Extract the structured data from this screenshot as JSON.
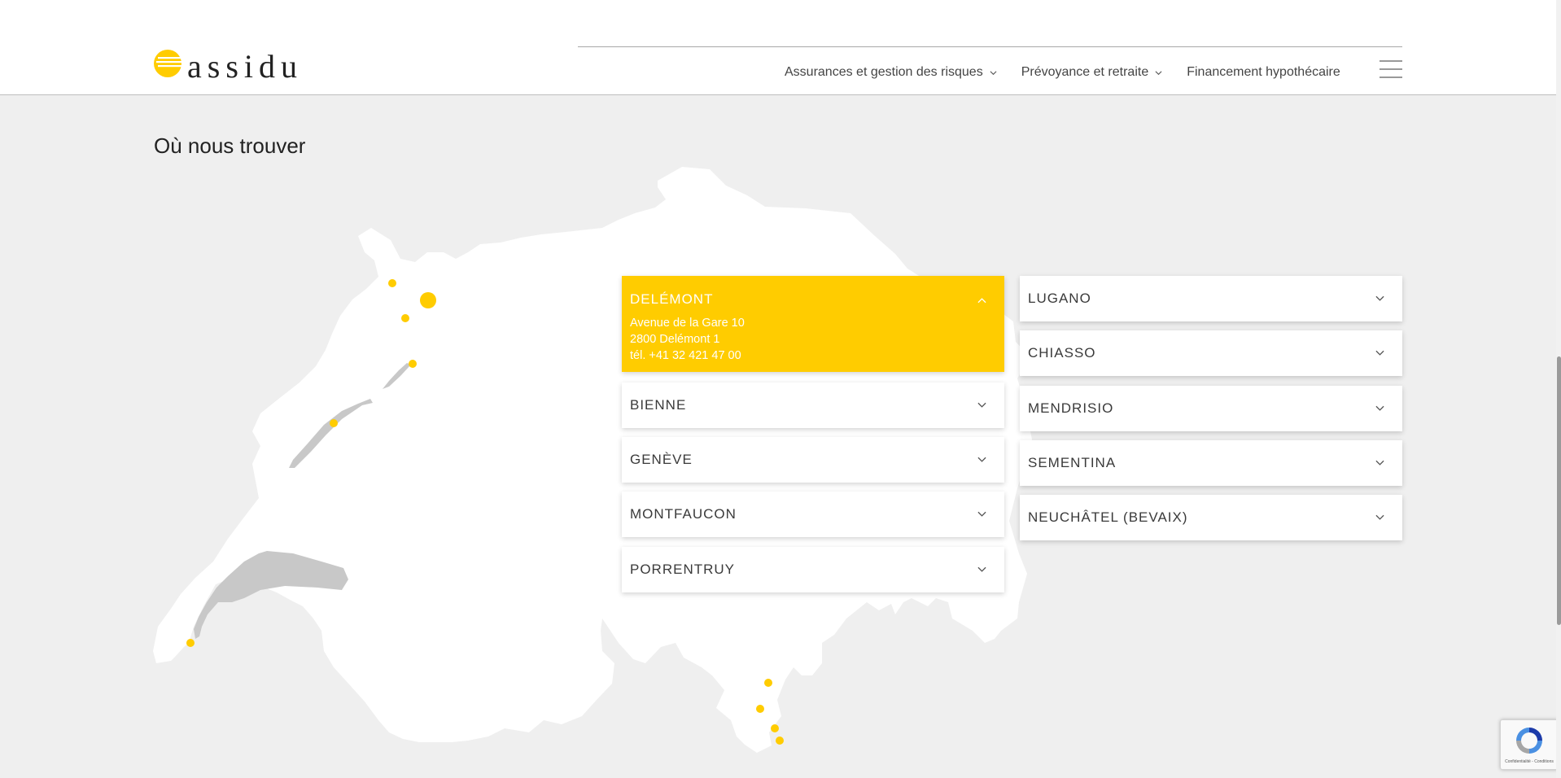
{
  "brand": {
    "logo_text": "assidu",
    "accent_color": "#ffcc00"
  },
  "nav": {
    "items": [
      {
        "label": "Assurances et gestion des risques",
        "has_dropdown": true
      },
      {
        "label": "Prévoyance et retraite",
        "has_dropdown": true
      },
      {
        "label": "Financement hypothécaire",
        "has_dropdown": false
      }
    ],
    "menu_icon": "hamburger-icon"
  },
  "section": {
    "title": "Où nous trouver"
  },
  "locations": {
    "left": [
      {
        "name": "DELÉMONT",
        "open": true,
        "address": [
          "Avenue de la Gare 10",
          "2800 Delémont 1",
          "tél. +41 32 421 47 00"
        ]
      },
      {
        "name": "BIENNE",
        "open": false
      },
      {
        "name": "GENÈVE",
        "open": false
      },
      {
        "name": "MONTFAUCON",
        "open": false
      },
      {
        "name": "PORRENTRUY",
        "open": false
      }
    ],
    "right": [
      {
        "name": "LUGANO",
        "open": false
      },
      {
        "name": "CHIASSO",
        "open": false
      },
      {
        "name": "MENDRISIO",
        "open": false
      },
      {
        "name": "SEMENTINA",
        "open": false
      },
      {
        "name": "NEUCHÂTEL (BEVAIX)",
        "open": false
      }
    ]
  },
  "recaptcha": {
    "text": "Confidentialité - Conditions"
  }
}
